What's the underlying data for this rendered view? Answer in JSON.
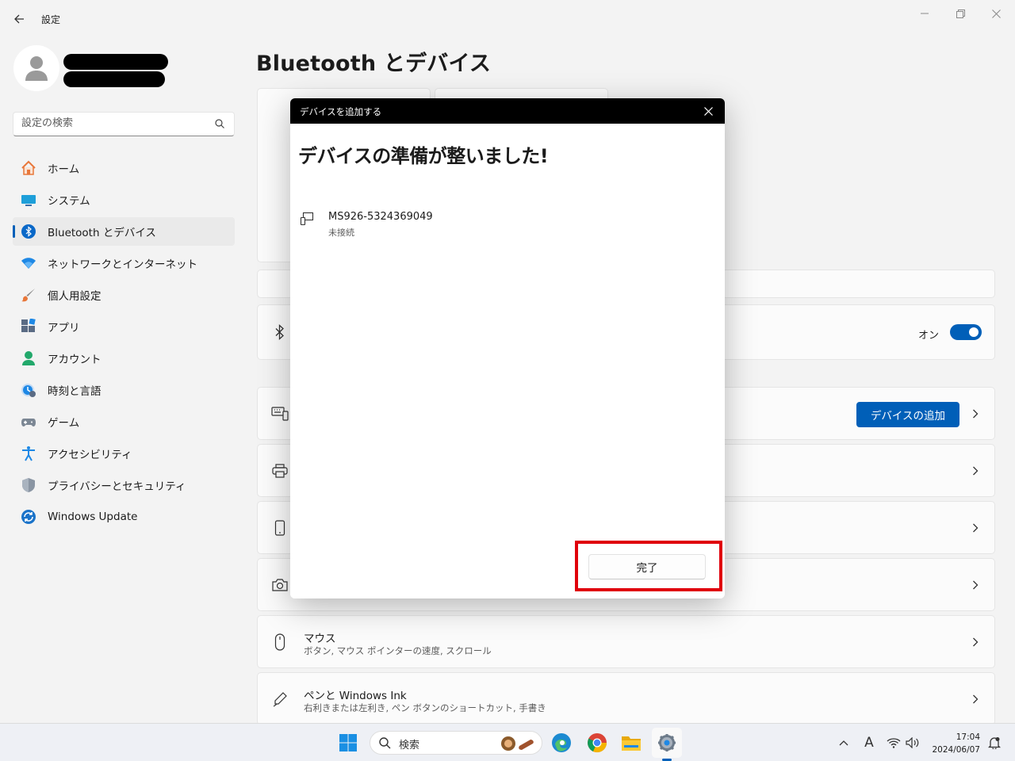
{
  "window": {
    "title": "設定",
    "controls": {
      "minimize": "—",
      "maximize": "❐",
      "close": "✕"
    }
  },
  "sidebar": {
    "search_placeholder": "設定の検索",
    "items": [
      {
        "label": "ホーム",
        "icon": "home-icon"
      },
      {
        "label": "システム",
        "icon": "system-icon"
      },
      {
        "label": "Bluetooth とデバイス",
        "icon": "bluetooth-icon",
        "active": true
      },
      {
        "label": "ネットワークとインターネット",
        "icon": "wifi-icon"
      },
      {
        "label": "個人用設定",
        "icon": "brush-icon"
      },
      {
        "label": "アプリ",
        "icon": "apps-icon"
      },
      {
        "label": "アカウント",
        "icon": "account-icon"
      },
      {
        "label": "時刻と言語",
        "icon": "clock-icon"
      },
      {
        "label": "ゲーム",
        "icon": "gamepad-icon"
      },
      {
        "label": "アクセシビリティ",
        "icon": "accessibility-icon"
      },
      {
        "label": "プライバシーとセキュリティ",
        "icon": "shield-icon"
      },
      {
        "label": "Windows Update",
        "icon": "update-icon"
      }
    ]
  },
  "main": {
    "title": "Bluetooth とデバイス",
    "bluetooth_toggle_label": "オン",
    "add_device_button": "デバイスの追加",
    "mouse": {
      "title": "マウス",
      "subtitle": "ボタン, マウス ポインターの速度, スクロール"
    },
    "pen": {
      "title": "ペンと Windows Ink",
      "subtitle": "右利きまたは左利き, ペン ボタンのショートカット, 手書き"
    }
  },
  "dialog": {
    "titlebar": "デバイスを追加する",
    "heading": "デバイスの準備が整いました!",
    "device_name": "MS926-5324369049",
    "device_status": "未接続",
    "done_button": "完了"
  },
  "taskbar": {
    "search_placeholder": "検索",
    "time": "17:04",
    "date": "2024/06/07",
    "ime_indicator": "A"
  },
  "colors": {
    "accent": "#005fb8",
    "highlight": "#e0000b"
  }
}
